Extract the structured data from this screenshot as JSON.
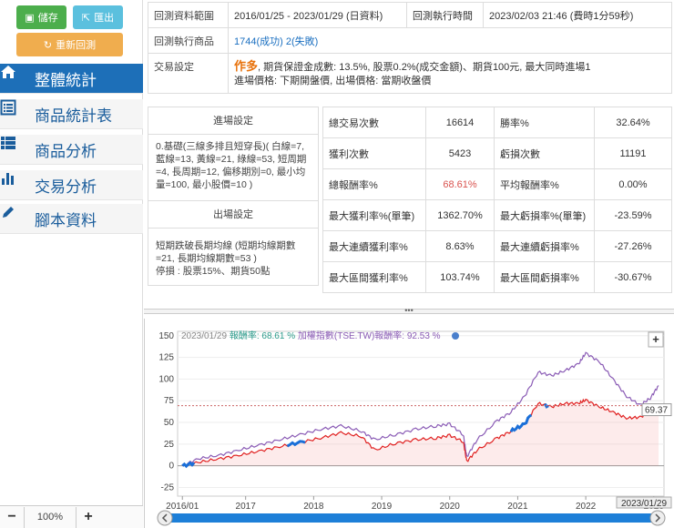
{
  "toolbar": {
    "save_label": "儲存",
    "export_label": "匯出",
    "rerun_label": "重新回測"
  },
  "nav": [
    {
      "label": "整體統計",
      "icon": "home-icon",
      "active": true
    },
    {
      "label": "商品統計表",
      "icon": "list-alt-icon"
    },
    {
      "label": "商品分析",
      "icon": "th-list-icon"
    },
    {
      "label": "交易分析",
      "icon": "bar-chart-icon"
    },
    {
      "label": "腳本資料",
      "icon": "pencil-icon"
    }
  ],
  "zoom": {
    "minus": "−",
    "value": "100%",
    "plus": "+"
  },
  "info": {
    "range_label": "回測資料範圍",
    "range_value": "2016/01/25 - 2023/01/29 (日資料)",
    "time_label": "回測執行時間",
    "time_value": "2023/02/03 21:46 (費時1分59秒)",
    "product_label": "回測執行商品",
    "product_ok": "1744(成功)",
    "product_fail": "2(失敗)",
    "trade_label": "交易設定",
    "trade_mode": "作多",
    "trade_line1": ", 期貨保證金成數: 13.5%, 股票0.2%(成交金額)、期貨100元, 最大同時進場1",
    "trade_line2": "進場價格: 下期開盤價, 出場價格: 當期收盤價"
  },
  "entry": {
    "title": "進場設定",
    "text": "0.基礎(三線多排且短穿長)( 白線=7, 藍線=13, 黃線=21, 綠線=53, 短周期=4, 長周期=12, 偏移期別=0, 最小均量=100, 最小股價=10 )"
  },
  "exit": {
    "title": "出場設定",
    "text1": "短期跌破長期均線 (短期均線期數=21, 長期均線期數=53 )",
    "text2": "停損 : 股票15%、期貨50點"
  },
  "stats": [
    [
      "總交易次數",
      "16614",
      "勝率%",
      "32.64%"
    ],
    [
      "獲利次數",
      "5423",
      "虧損次數",
      "11191"
    ],
    [
      "總報酬率%",
      "68.61%",
      "平均報酬率%",
      "0.00%"
    ],
    [
      "最大獲利率%(單筆)",
      "1362.70%",
      "最大虧損率%(單筆)",
      "-23.59%"
    ],
    [
      "最大連續獲利率%",
      "8.63%",
      "最大連續虧損率%",
      "-27.26%"
    ],
    [
      "最大區間獲利率%",
      "103.74%",
      "最大區間虧損率%",
      "-30.67%"
    ]
  ],
  "divider_label": "•••",
  "chart_data": {
    "type": "line",
    "header_date": "2023/01/29",
    "series": [
      {
        "name": "報酬率",
        "value_text": "68.61 %",
        "color": "#e02020",
        "x": [
          2016.07,
          2016.3,
          2016.6,
          2016.9,
          2017.2,
          2017.5,
          2017.8,
          2018.1,
          2018.4,
          2018.7,
          2018.9,
          2019.2,
          2019.5,
          2019.8,
          2020.0,
          2020.2,
          2020.25,
          2020.4,
          2020.7,
          2020.9,
          2021.1,
          2021.3,
          2021.5,
          2021.7,
          2021.9,
          2022.0,
          2022.2,
          2022.4,
          2022.6,
          2022.8,
          2022.95,
          2023.07
        ],
        "y": [
          0,
          4,
          8,
          12,
          17,
          22,
          27,
          32,
          38,
          34,
          18,
          26,
          30,
          32,
          35,
          28,
          5,
          18,
          32,
          40,
          48,
          72,
          68,
          72,
          72,
          76,
          68,
          62,
          55,
          56,
          62,
          69.37
        ]
      },
      {
        "name": "加權指數(TSE.TW)報酬率",
        "value_text": "92.53 %",
        "color": "#8a5bb5",
        "x": [
          2016.07,
          2016.3,
          2016.6,
          2016.9,
          2017.2,
          2017.5,
          2017.8,
          2018.1,
          2018.4,
          2018.7,
          2018.9,
          2019.2,
          2019.5,
          2019.8,
          2020.0,
          2020.2,
          2020.25,
          2020.4,
          2020.7,
          2020.9,
          2021.1,
          2021.3,
          2021.5,
          2021.7,
          2021.9,
          2022.0,
          2022.2,
          2022.4,
          2022.6,
          2022.8,
          2022.95,
          2023.07
        ],
        "y": [
          0,
          8,
          12,
          18,
          24,
          30,
          36,
          42,
          46,
          40,
          30,
          36,
          42,
          46,
          48,
          36,
          10,
          30,
          52,
          62,
          80,
          108,
          104,
          110,
          118,
          130,
          120,
          100,
          80,
          70,
          78,
          92.53
        ]
      }
    ],
    "x_ticks": [
      "2016/01",
      "2017",
      "2018",
      "2019",
      "2020",
      "2021",
      "2022",
      "2023"
    ],
    "x_tick_values": [
      2016.07,
      2017,
      2018,
      2019,
      2020,
      2021,
      2022,
      2023
    ],
    "y_ticks": [
      150,
      125,
      100,
      75,
      50,
      25,
      0,
      -25
    ],
    "ylim": [
      -35,
      155
    ],
    "xlim": [
      2016.0,
      2023.15
    ],
    "last_value_label": "69.37",
    "end_date_label": "2023/01/29",
    "expand_label": "+"
  }
}
